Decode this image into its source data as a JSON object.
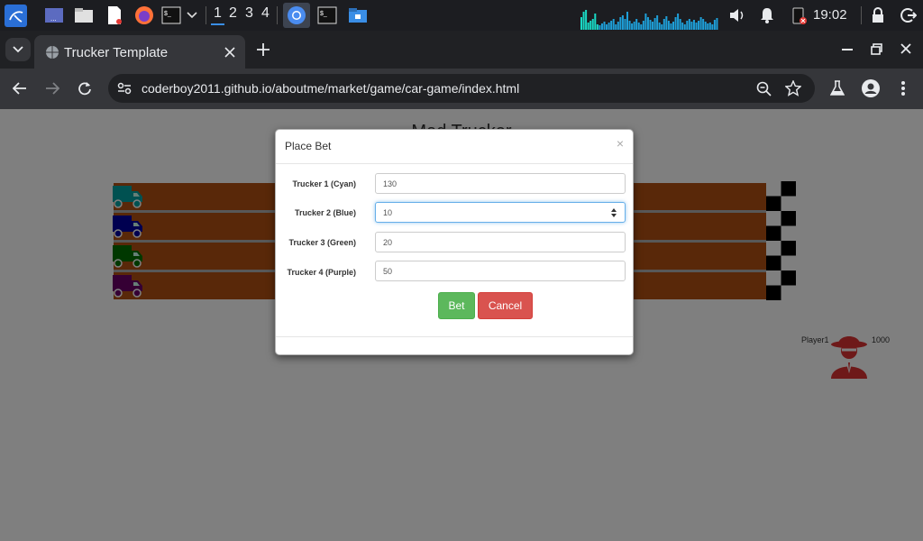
{
  "taskbar": {
    "workspaces": [
      "1",
      "2",
      "3",
      "4"
    ],
    "active_workspace": "1",
    "clock": "19:02"
  },
  "browser": {
    "tab_title": "Trucker Template",
    "url": "coderboy2011.github.io/aboutme/market/game/car-game/index.html"
  },
  "game": {
    "title": "Mad Trucker",
    "player_name": "Player1",
    "player_money": "1000",
    "trucks": [
      {
        "color": "#00a2a2"
      },
      {
        "color": "#0000a0"
      },
      {
        "color": "#007000"
      },
      {
        "color": "#6a0068"
      }
    ]
  },
  "modal": {
    "title": "Place Bet",
    "close_symbol": "×",
    "rows": [
      {
        "label": "Trucker 1 (Cyan)",
        "value": "130"
      },
      {
        "label": "Trucker 2 (Blue)",
        "value": "10"
      },
      {
        "label": "Trucker 3 (Green)",
        "value": "20"
      },
      {
        "label": "Trucker 4 (Purple)",
        "value": "50"
      }
    ],
    "bet_label": "Bet",
    "cancel_label": "Cancel"
  }
}
